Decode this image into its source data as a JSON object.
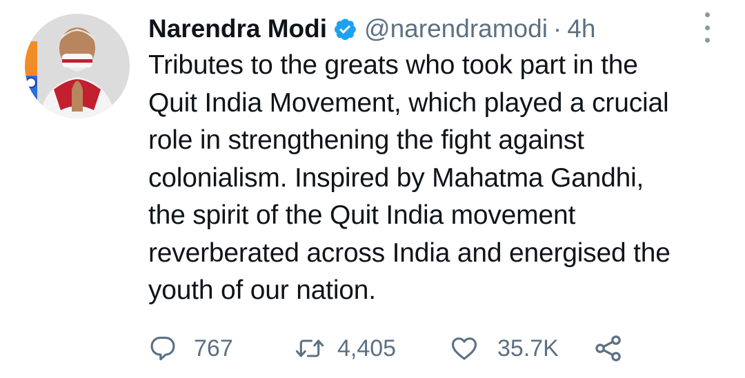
{
  "tweet": {
    "author": {
      "name": "Narendra Modi",
      "handle": "@narendramodi",
      "verified": true
    },
    "separator": "·",
    "time": "4h",
    "text_lines": [
      "Tributes to the greats who took part in the",
      "Quit India Movement, which played a crucial",
      "role in strengthening the fight against",
      "colonialism. Inspired by Mahatma Gandhi,",
      "the spirit of the Quit India movement",
      "reverberated across India and energised the",
      "youth of our nation."
    ],
    "stats": {
      "replies": "767",
      "retweets": "4,405",
      "likes": "35.7K"
    }
  },
  "icons": {
    "verified": "verified-badge-icon",
    "more": "more-vertical-icon",
    "reply": "reply-icon",
    "retweet": "retweet-icon",
    "like": "heart-icon",
    "share": "share-icon"
  },
  "colors": {
    "text_primary": "#0f1419",
    "text_secondary": "#5b7083",
    "verified_blue": "#1da1f2",
    "icon_gray": "#5b7083"
  }
}
